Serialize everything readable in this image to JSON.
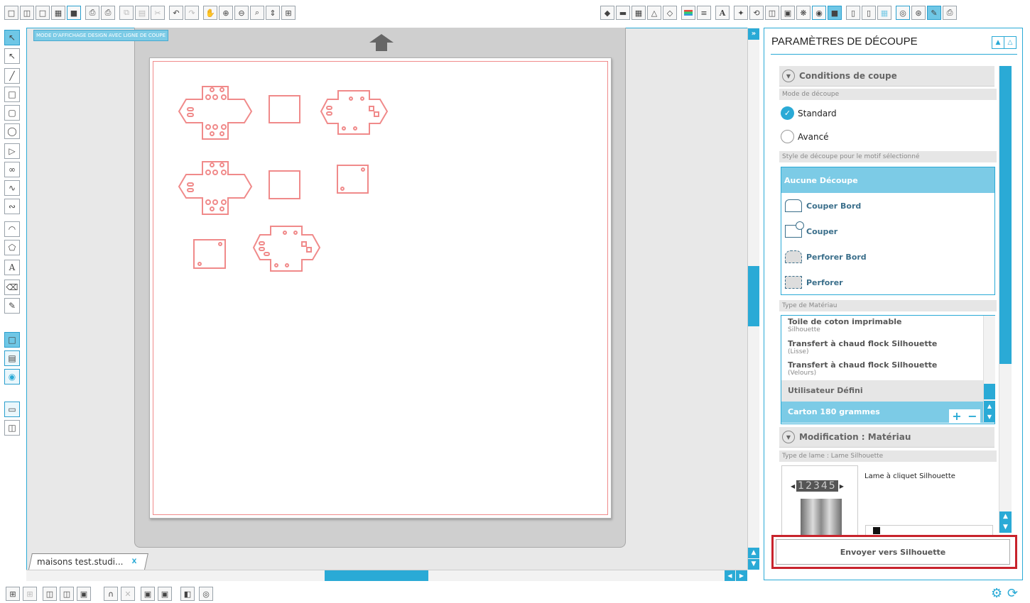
{
  "canvas": {
    "mode_label": "MODE D'AFFICHAGE DESIGN AVEC LIGNE DE COUPE",
    "doc_tab": "maisons test.studi...",
    "doc_tab_close": "X"
  },
  "panel": {
    "title": "PARAMÈTRES DE DÉCOUPE",
    "conditions_title": "Conditions de coupe",
    "mode_label": "Mode de découpe",
    "mode_standard": "Standard",
    "mode_avance": "Avancé",
    "mode_selected": "Standard",
    "style_label": "Style de découpe pour le motif sélectionné",
    "styles": [
      "Aucune Découpe",
      "Couper Bord",
      "Couper",
      "Perforer Bord",
      "Perforer"
    ],
    "style_selected": "Aucune Découpe",
    "material_label": "Type de Matériau",
    "materials": [
      {
        "name": "Toile de coton imprimable",
        "sub": "Silhouette"
      },
      {
        "name": "Transfert à chaud flock Silhouette",
        "sub": "(Lisse)"
      },
      {
        "name": "Transfert à chaud flock Silhouette",
        "sub": "(Velours)"
      }
    ],
    "user_defined": "Utilisateur Défini",
    "selected_material": "Carton 180 grammes",
    "add_symbol": "+",
    "remove_symbol": "−",
    "modification_title": "Modification : Matériau",
    "blade_label": "Type de lame : Lame Silhouette",
    "blade_name": "Lame à cliquet Silhouette",
    "blade_digits": "12345",
    "send_button": "Envoyer vers Silhouette"
  },
  "colors": {
    "accent": "#2aaad6",
    "selection": "#7ccbe6",
    "cut_line": "#f08a8a",
    "send_border": "#c8232c"
  },
  "icons": {
    "top_toolbar_left": [
      "new-doc-icon",
      "open-icon",
      "template-icon",
      "save-icon",
      "save-as-icon",
      "print-icon",
      "print-cut-icon",
      "copy-icon",
      "paste-icon",
      "cut-icon",
      "undo-icon",
      "redo-icon",
      "pan-icon",
      "zoom-in-icon",
      "zoom-out-icon",
      "zoom-select-icon",
      "drag-zoom-icon",
      "fit-page-icon"
    ],
    "top_toolbar_right": [
      "fill-icon",
      "page-icon",
      "grid-icon",
      "transform-icon",
      "point-icon",
      "line-color-icon",
      "line-style-icon",
      "text-icon",
      "replicate-icon",
      "offset-icon",
      "align-icon",
      "modify-icon",
      "trace-icon",
      "store-icon",
      "design-icon",
      "send-icon",
      "library-icon",
      "sketch-icon",
      "print-border-icon",
      "crosshair-icon",
      "paint-icon",
      "send-to-icon"
    ],
    "left_tools": [
      "select-icon",
      "edit-points-icon",
      "line-icon",
      "rectangle-icon",
      "rounded-rect-icon",
      "ellipse-icon",
      "polygon-icon",
      "curve-icon",
      "freehand-icon",
      "smooth-freehand-icon",
      "arc-icon",
      "regular-polygon-icon",
      "text-tool-icon",
      "eraser-icon",
      "knife-icon"
    ]
  }
}
